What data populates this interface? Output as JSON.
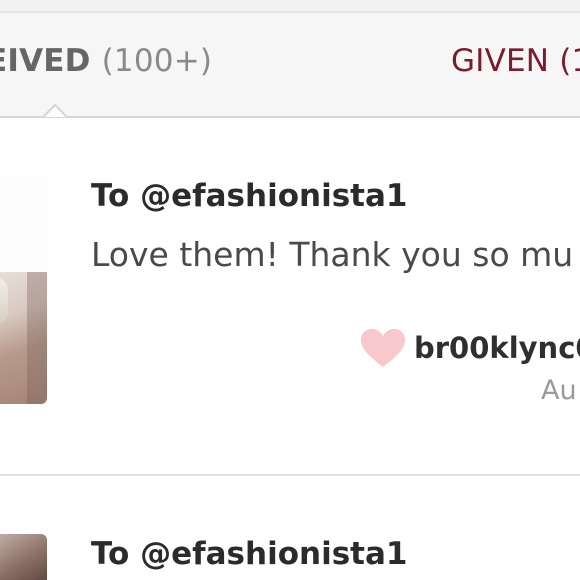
{
  "tabs": {
    "received_label": "EIVED",
    "received_count": "(100+)",
    "given_label": "GIVEN (1"
  },
  "love_notes": [
    {
      "to": "To @efashionista1",
      "message": "Love them! Thank you so mu",
      "from_user": "br00klync0",
      "date": "Au"
    },
    {
      "to": "To @efashionista1"
    }
  ],
  "icons": {
    "heart": "heart-icon",
    "tab_caret": "caret-up-icon"
  },
  "colors": {
    "given_tab": "#7b1b2b",
    "heart": "#f7c9cc",
    "background": "#f7f6f6"
  }
}
